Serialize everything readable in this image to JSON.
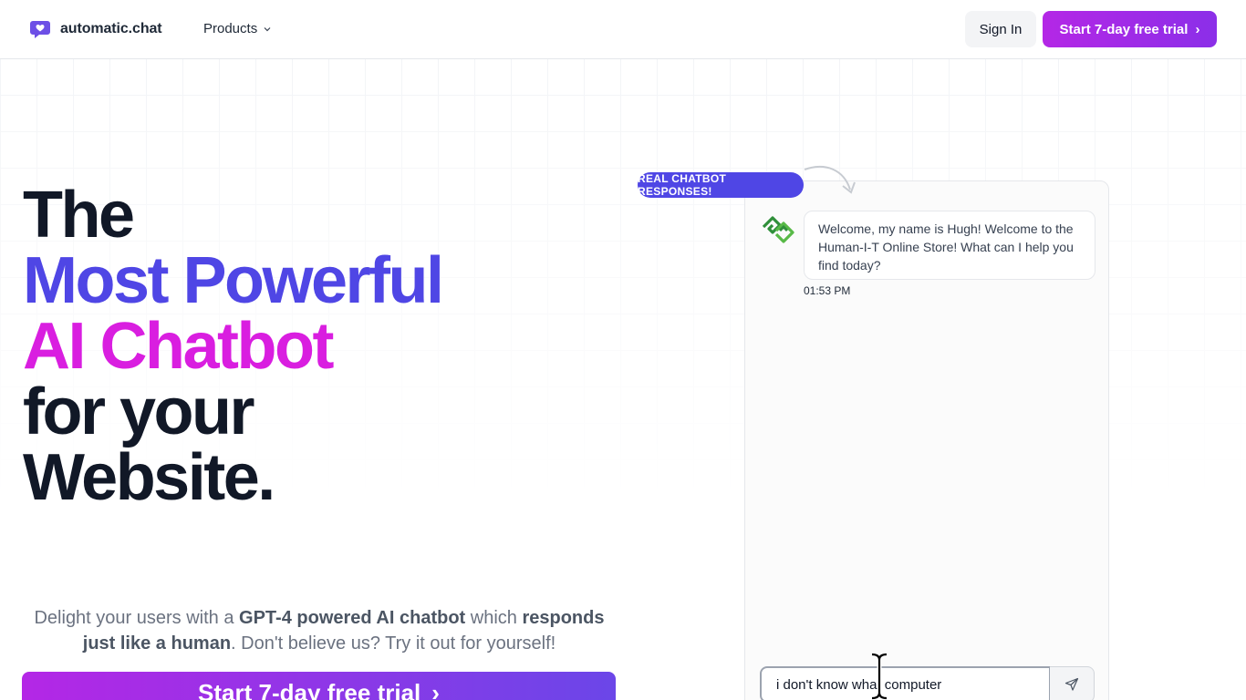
{
  "header": {
    "brand": "automatic.chat",
    "products_label": "Products",
    "signin_label": "Sign In",
    "trial_label": "Start 7-day free trial",
    "chevron_right": "›"
  },
  "hero": {
    "line1": "The",
    "line2": "Most Powerful",
    "line3": "AI Chatbot",
    "line4": "for your",
    "line5": "Website.",
    "desc_1": "Delight your users with a ",
    "desc_bold_1": "GPT-4 powered AI chatbot",
    "desc_2": " which ",
    "desc_bold_2": "responds just like a human",
    "desc_3": ". Don't believe us? Try it out for yourself!",
    "cta_label": "Start 7-day free trial",
    "cta_chevron": "›"
  },
  "chat": {
    "badge": "REAL CHATBOT RESPONSES!",
    "bot_message": "Welcome, my name is Hugh! Welcome to the Human-I-T Online Store! What can I help you find today?",
    "bot_time": "01:53 PM",
    "input_value": "i don't know what computer"
  },
  "colors": {
    "brand_purple": "#b427e6",
    "indigo": "#4f46e5",
    "magenta": "#d91ee0"
  },
  "icons": {
    "logo": "chat-heart-icon",
    "products_chevron": "chevron-down-icon",
    "send": "send-icon",
    "bot_avatar": "bot-logo-icon",
    "arrow": "curved-arrow-icon"
  }
}
